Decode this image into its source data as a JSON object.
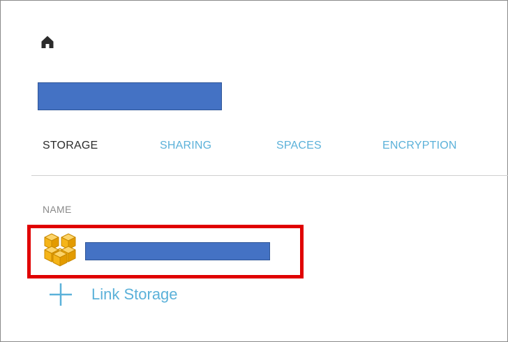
{
  "header": {
    "home_icon": "home-icon",
    "title_redacted": true,
    "redaction_color": "#4472c4"
  },
  "tabs": [
    {
      "label": "STORAGE",
      "active": true
    },
    {
      "label": "SHARING",
      "active": false
    },
    {
      "label": "SPACES",
      "active": false
    },
    {
      "label": "ENCRYPTION",
      "active": false
    }
  ],
  "table": {
    "column_header": "NAME",
    "rows": [
      {
        "icon": "aws-cubes-icon",
        "name_redacted": true,
        "highlighted": true
      }
    ]
  },
  "actions": {
    "link_storage_label": "Link Storage",
    "link_storage_icon": "plus-icon"
  },
  "colors": {
    "accent": "#5bb1d9",
    "highlight_border": "#e00000",
    "aws_orange": "#f5b418",
    "active_tab_text": "#2b2b2b"
  }
}
